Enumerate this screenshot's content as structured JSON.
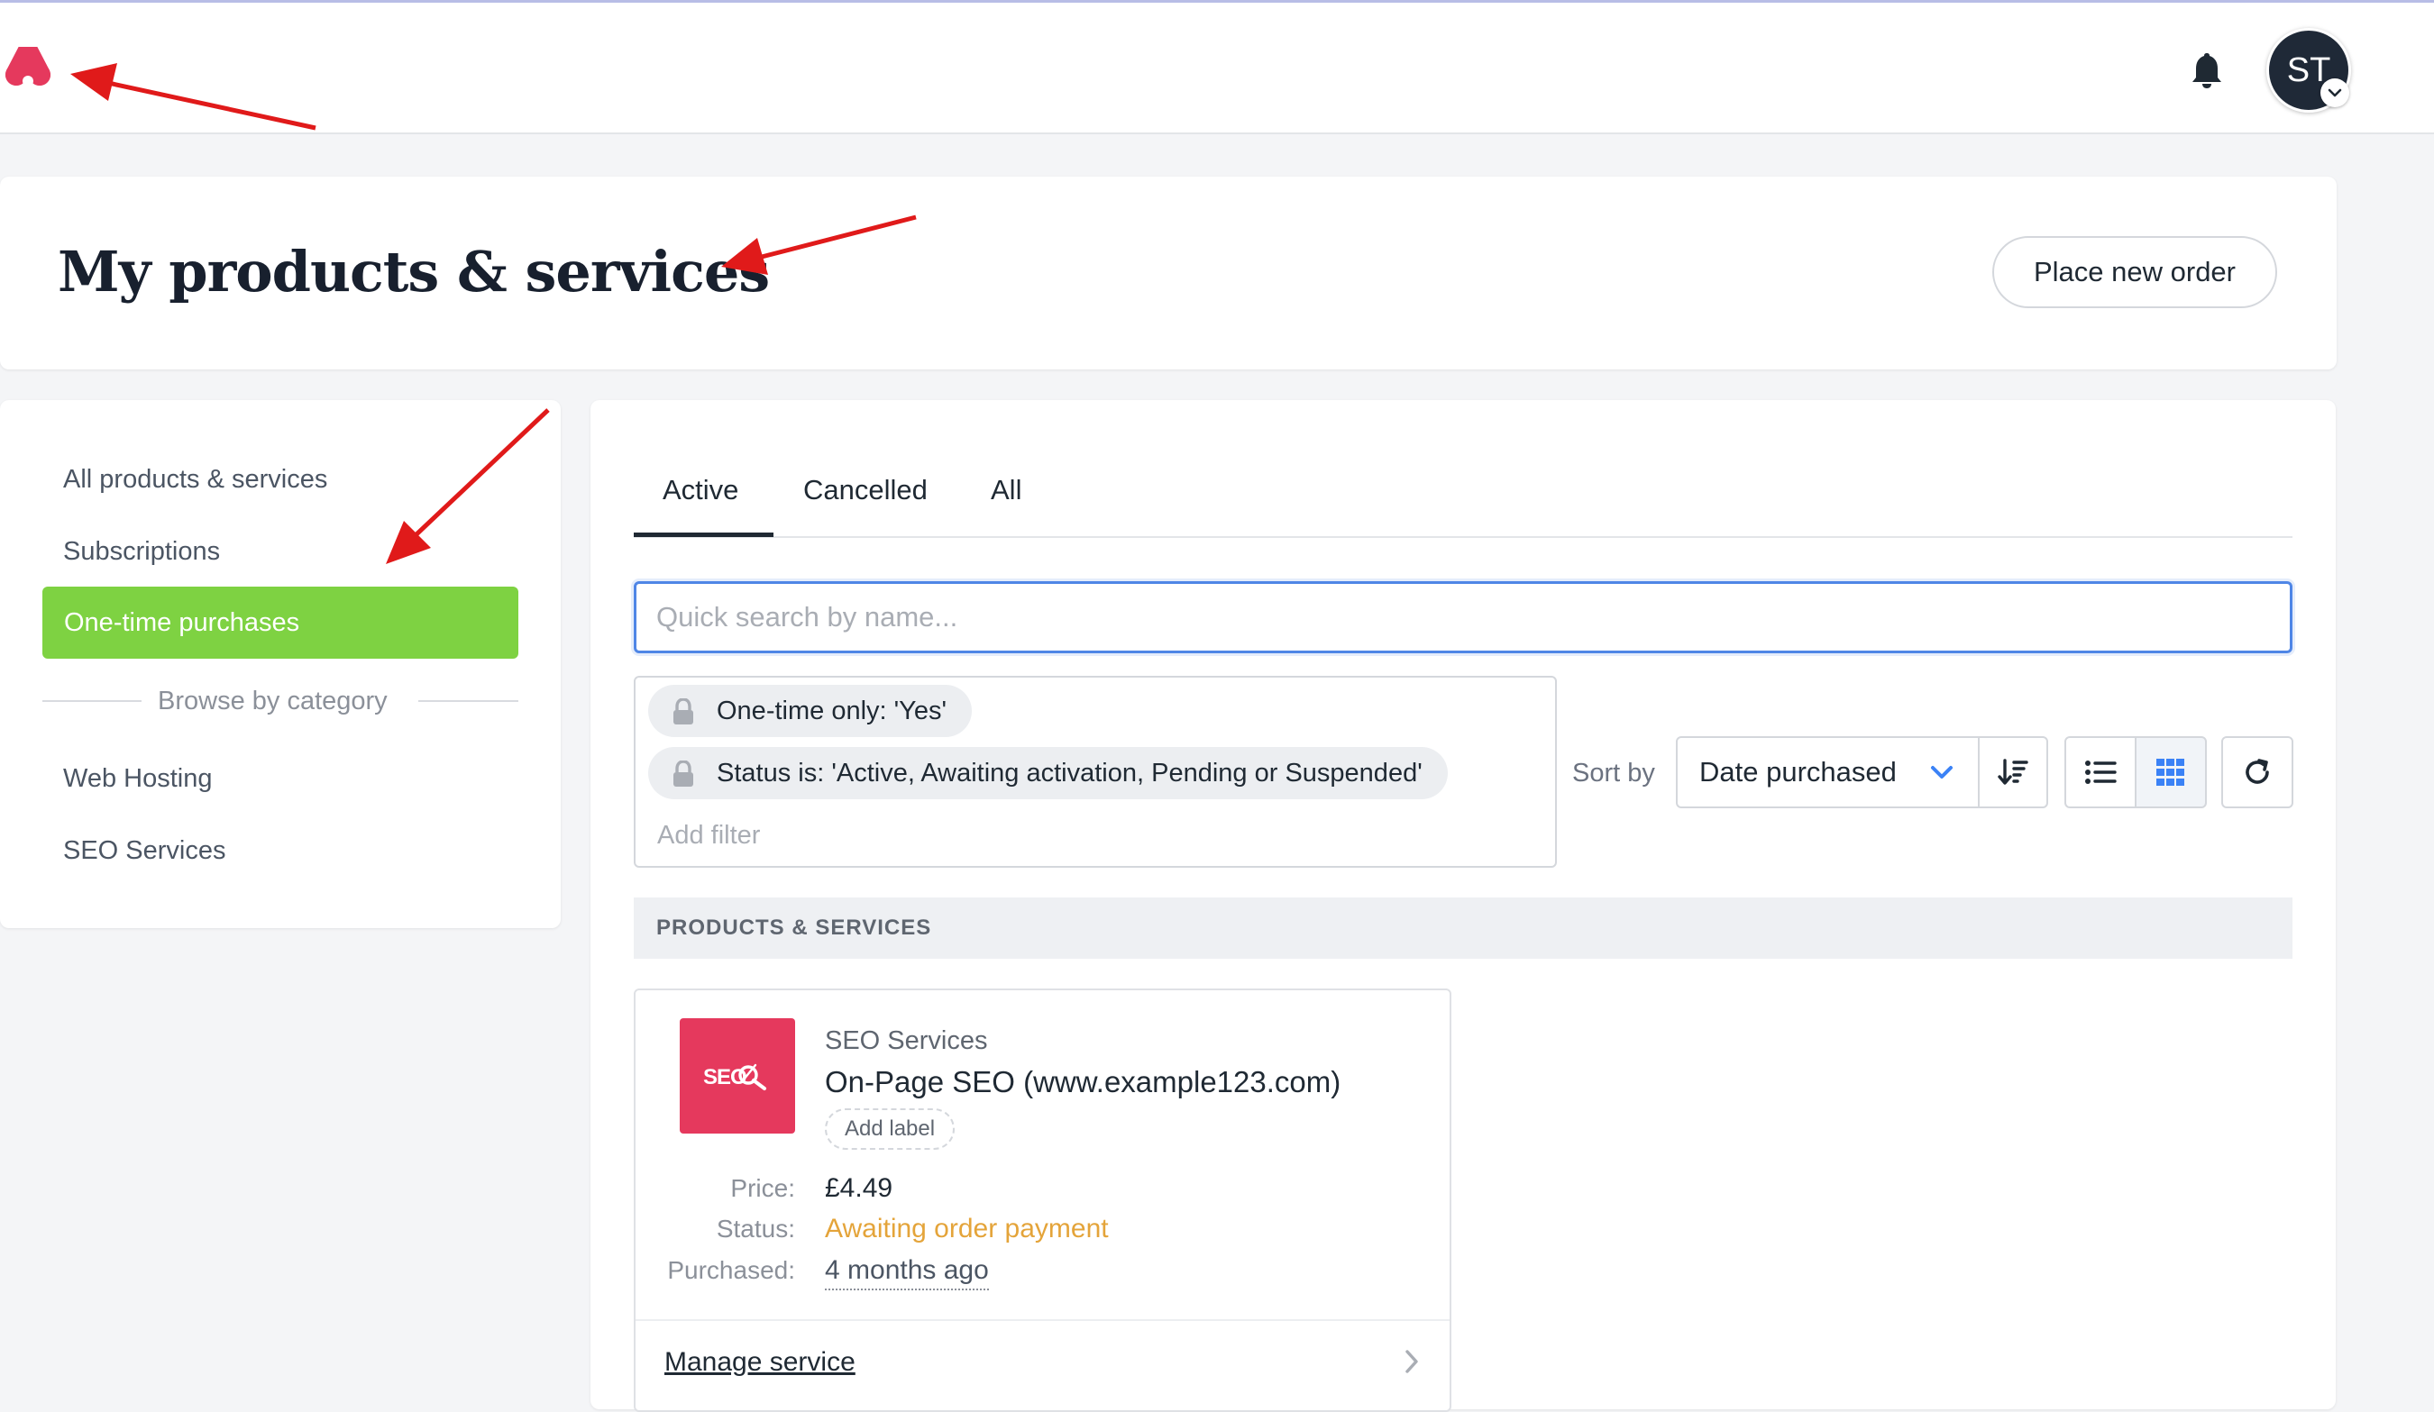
{
  "header": {
    "logo": "brand-logo",
    "notifications_icon": "bell-icon",
    "avatar_initials": "ST"
  },
  "page": {
    "title": "My products & services",
    "place_order_label": "Place new order"
  },
  "sidebar": {
    "items": [
      {
        "label": "All products & services"
      },
      {
        "label": "Subscriptions"
      },
      {
        "label": "One-time purchases",
        "active": true
      }
    ],
    "browse_label": "Browse by category",
    "categories": [
      {
        "label": "Web Hosting"
      },
      {
        "label": "SEO Services"
      }
    ]
  },
  "tabs": [
    {
      "label": "Active",
      "active": true
    },
    {
      "label": "Cancelled"
    },
    {
      "label": "All"
    }
  ],
  "search": {
    "placeholder": "Quick search by name...",
    "value": ""
  },
  "filters": {
    "chips": [
      {
        "label": "One-time only: 'Yes'"
      },
      {
        "label": "Status is: 'Active, Awaiting activation, Pending or Suspended'"
      }
    ],
    "add_filter_placeholder": "Add filter"
  },
  "sort": {
    "label": "Sort by",
    "selected": "Date purchased",
    "view_mode": "grid"
  },
  "section": {
    "header": "PRODUCTS & SERVICES"
  },
  "products": [
    {
      "logo_text": "SEO",
      "category": "SEO Services",
      "name": "On-Page SEO (www.example123.com)",
      "add_label": "Add label",
      "price_label": "Price:",
      "price": "£4.49",
      "status_label": "Status:",
      "status": "Awaiting order payment",
      "purchased_label": "Purchased:",
      "purchased": "4 months ago",
      "manage_label": "Manage service"
    }
  ],
  "colors": {
    "brand": "#e5395d",
    "active_nav": "#7ed242",
    "status_pending": "#e4a43a",
    "focus": "#4f86e6",
    "annotation_arrow": "#e01a1a"
  }
}
